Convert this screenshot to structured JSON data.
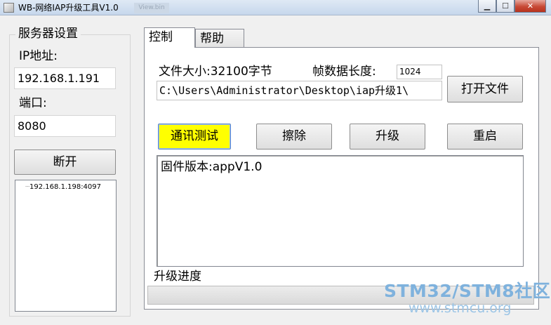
{
  "window": {
    "title": "WB-网络IAP升级工具V1.0",
    "ghost_tab": "View.bin",
    "buttons": {
      "minimize": "▁",
      "maximize": "☐",
      "close": "✕"
    }
  },
  "server": {
    "group_title": "服务器设置",
    "ip_label": "IP地址:",
    "ip_value": "192.168.1.191",
    "port_label": "端口:",
    "port_value": "8080",
    "disconnect_label": "断开",
    "clients": [
      "192.168.1.198:4097"
    ]
  },
  "tabs": [
    {
      "label": "控制",
      "active": true
    },
    {
      "label": "帮助",
      "active": false
    }
  ],
  "control": {
    "file_size_text": "文件大小:32100字节",
    "frame_len_label": "帧数据长度:",
    "frame_len_value": "1024",
    "file_path": "C:\\Users\\Administrator\\Desktop\\iap升级1\\",
    "open_file_label": "打开文件",
    "comm_test_label": "通讯测试",
    "erase_label": "擦除",
    "upgrade_label": "升级",
    "restart_label": "重启",
    "log_lines": [
      "固件版本:appV1.0"
    ],
    "progress_label": "升级进度",
    "progress_value": 0
  },
  "watermark": {
    "main": "STM32/STM8社区",
    "sub": "www.stmcu.org"
  },
  "colors": {
    "comm_test_bg": "#ffff00",
    "progress_fill": "#4bc22b",
    "watermark": "#7fb2dd"
  }
}
